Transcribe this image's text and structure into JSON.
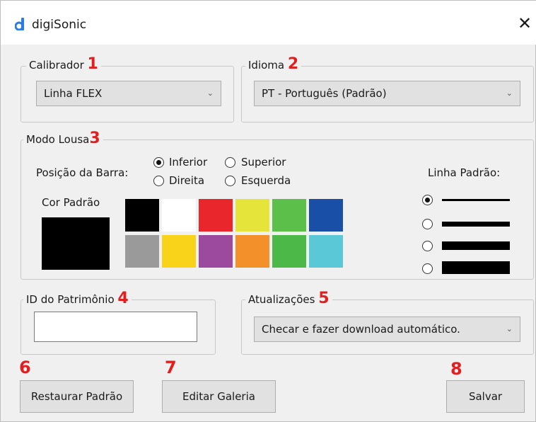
{
  "window": {
    "title": "digiSonic",
    "close_glyph": "✕",
    "logo_icon": "digisonic-logo-icon"
  },
  "calibrador": {
    "legend": "Calibrador",
    "number": "1",
    "selected": "Linha FLEX"
  },
  "idioma": {
    "legend": "Idioma",
    "number": "2",
    "selected": "PT - Português (Padrão)"
  },
  "modo_lousa": {
    "legend": "Modo Lousa",
    "number": "3",
    "posicao_label": "Posição da Barra:",
    "posicao_options": [
      {
        "label": "Inferior",
        "selected": true
      },
      {
        "label": "Superior",
        "selected": false
      },
      {
        "label": "Direita",
        "selected": false
      },
      {
        "label": "Esquerda",
        "selected": false
      }
    ],
    "cor_padrao_label": "Cor Padrão",
    "cor_padrao_value": "#000000",
    "colors_row1": [
      "#000000",
      "#ffffff",
      "#e8262b",
      "#e5e43a",
      "#5bbf4a",
      "#1a4fa8"
    ],
    "colors_row2": [
      "#9a9a9a",
      "#f9d21a",
      "#9c4a9e",
      "#f3902a",
      "#4cb848",
      "#5bc8d8"
    ],
    "linha_padrao_label": "Linha Padrão:",
    "linha_options": [
      {
        "selected": true,
        "thickness": "thin"
      },
      {
        "selected": false,
        "thickness": "medium"
      },
      {
        "selected": false,
        "thickness": "thick"
      },
      {
        "selected": false,
        "thickness": "extra-thick"
      }
    ]
  },
  "patrimonio": {
    "legend": "ID do Patrimônio",
    "number": "4",
    "value": ""
  },
  "atualizacoes": {
    "legend": "Atualizações",
    "number": "5",
    "selected": "Checar e fazer download automático."
  },
  "buttons": {
    "restaurar": {
      "label": "Restaurar Padrão",
      "number": "6"
    },
    "editar": {
      "label": "Editar Galeria",
      "number": "7"
    },
    "salvar": {
      "label": "Salvar",
      "number": "8"
    }
  },
  "chevron_glyph": "⌄"
}
